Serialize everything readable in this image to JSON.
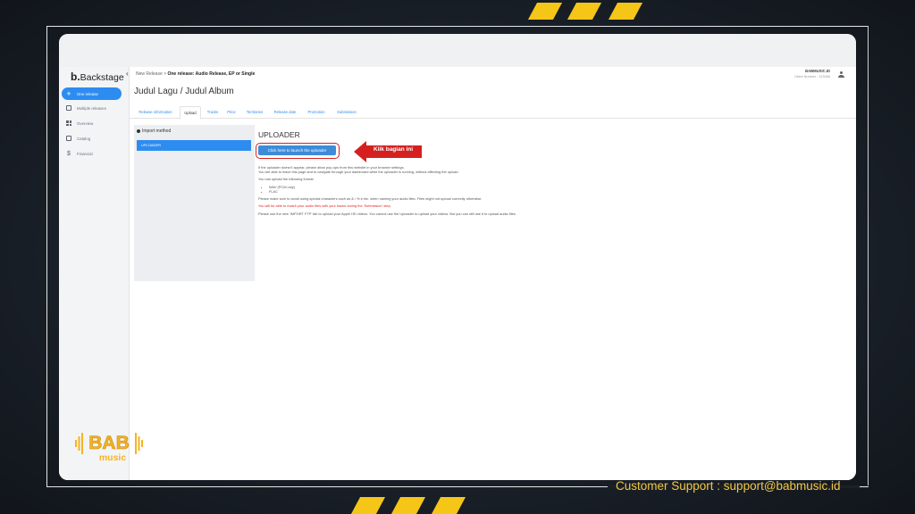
{
  "sidebar": {
    "logo_mark": "b.",
    "logo_text": "Backstage",
    "items": [
      {
        "label": "One release",
        "icon": "plus-icon",
        "active": true
      },
      {
        "label": "Multiple releases",
        "icon": "stack-icon",
        "active": false
      },
      {
        "label": "Overview",
        "icon": "dashboard-icon",
        "active": false
      },
      {
        "label": "Catalog",
        "icon": "catalog-icon",
        "active": false
      },
      {
        "label": "Financial",
        "icon": "dollar-icon",
        "active": false
      }
    ]
  },
  "topbar": {
    "breadcrumb_parent": "New Release",
    "breadcrumb_separator": " > ",
    "breadcrumb_current": "One release: Audio Release, EP or Single",
    "account_name": "BABMUSIC.ID",
    "client_number": "Client Number : 123456"
  },
  "page": {
    "title": "Judul Lagu / Judul Album"
  },
  "tabs": [
    {
      "label": "Release information",
      "active": false
    },
    {
      "label": "Upload",
      "active": true
    },
    {
      "label": "Tracks",
      "active": false
    },
    {
      "label": "Price",
      "active": false
    },
    {
      "label": "Territories",
      "active": false
    },
    {
      "label": "Release date",
      "active": false
    },
    {
      "label": "Promotion",
      "active": false
    },
    {
      "label": "Submission",
      "active": false
    }
  ],
  "import_method": {
    "heading": "Import method",
    "selected": "UPLOADER"
  },
  "uploader": {
    "title": "UPLOADER",
    "launch_button": "Click here to launch the uploader",
    "annotation": "Klik bagian ini",
    "line1": "If the uploader doesn't appear, please allow pop-ups from this website in your browser settings.",
    "line2": "You are able to leave this page and to navigate through your dashboard while the uploader is running, without affecting the upload.",
    "formats_intro": "You can upload the following format:",
    "formats": [
      "WAV (PCM only)",
      "FLAC"
    ],
    "special_chars": "Please make sure to avoid using special characters such as & / % # etc. when naming your audio files. Files might not upload correctly otherwise.",
    "match_note": "You will be able to match your audio files with your tracks during the 'Submission' step.",
    "ftp_note": "Please use the new 'IMPORT FTP' tab to upload your Apple HD videos. You cannot use the Uploader to upload your videos. But you can still use it to upload audio files."
  },
  "branding": {
    "logo_top": "BAB",
    "logo_bottom": "music",
    "support": "Customer Support : support@babmusic.id"
  },
  "colors": {
    "accent": "#2d8cf0",
    "highlight_red": "#d62020",
    "brand_yellow": "#f5c518"
  }
}
